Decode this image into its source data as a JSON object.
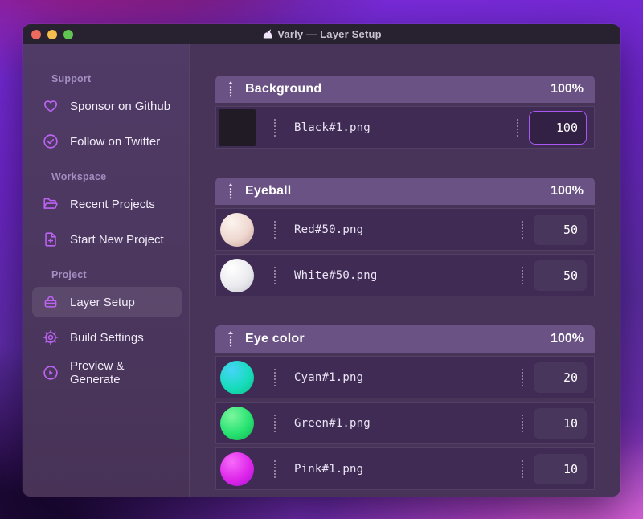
{
  "window": {
    "title": "Varly — Layer Setup"
  },
  "colors": {
    "accent": "#a958f2",
    "icon": "#bd63f3",
    "traffic_red": "#ed6a5e",
    "traffic_yellow": "#f5bf4f",
    "traffic_green": "#61c554"
  },
  "sidebar": {
    "sections": [
      {
        "label": "Support",
        "items": [
          {
            "icon": "heart-icon",
            "label": "Sponsor on Github",
            "active": false
          },
          {
            "icon": "badge-check-icon",
            "label": "Follow on Twitter",
            "active": false
          }
        ]
      },
      {
        "label": "Workspace",
        "items": [
          {
            "icon": "folder-icon",
            "label": "Recent Projects",
            "active": false
          },
          {
            "icon": "file-plus-icon",
            "label": "Start New Project",
            "active": false
          }
        ]
      },
      {
        "label": "Project",
        "items": [
          {
            "icon": "layers-icon",
            "label": "Layer Setup",
            "active": true
          },
          {
            "icon": "gear-icon",
            "label": "Build Settings",
            "active": false
          },
          {
            "icon": "play-circle-icon",
            "label": "Preview & Generate",
            "active": false
          }
        ]
      }
    ]
  },
  "main": {
    "groups": [
      {
        "name": "Background",
        "weight": "100%",
        "items": [
          {
            "file": "Black#1.png",
            "value": "100",
            "focused": true,
            "thumb": {
              "shape": "square",
              "colors": [
                "#211b26"
              ]
            }
          }
        ]
      },
      {
        "name": "Eyeball",
        "weight": "100%",
        "items": [
          {
            "file": "Red#50.png",
            "value": "50",
            "focused": false,
            "thumb": {
              "shape": "sphere",
              "colors": [
                "#fdf4ef",
                "#eed7d0",
                "#c5a098"
              ]
            }
          },
          {
            "file": "White#50.png",
            "value": "50",
            "focused": false,
            "thumb": {
              "shape": "sphere",
              "colors": [
                "#ffffff",
                "#ebebef",
                "#c3c2cb"
              ]
            }
          }
        ]
      },
      {
        "name": "Eye color",
        "weight": "100%",
        "items": [
          {
            "file": "Cyan#1.png",
            "value": "20",
            "focused": false,
            "thumb": {
              "shape": "sphere",
              "colors": [
                "#47d4f8",
                "#17dcbc",
                "#0bc184"
              ]
            }
          },
          {
            "file": "Green#1.png",
            "value": "10",
            "focused": false,
            "thumb": {
              "shape": "sphere",
              "colors": [
                "#7df69f",
                "#27e371",
                "#12b64d"
              ]
            }
          },
          {
            "file": "Pink#1.png",
            "value": "10",
            "focused": false,
            "thumb": {
              "shape": "sphere",
              "colors": [
                "#f76bfa",
                "#de27ea",
                "#a812d4"
              ]
            }
          }
        ]
      }
    ]
  }
}
